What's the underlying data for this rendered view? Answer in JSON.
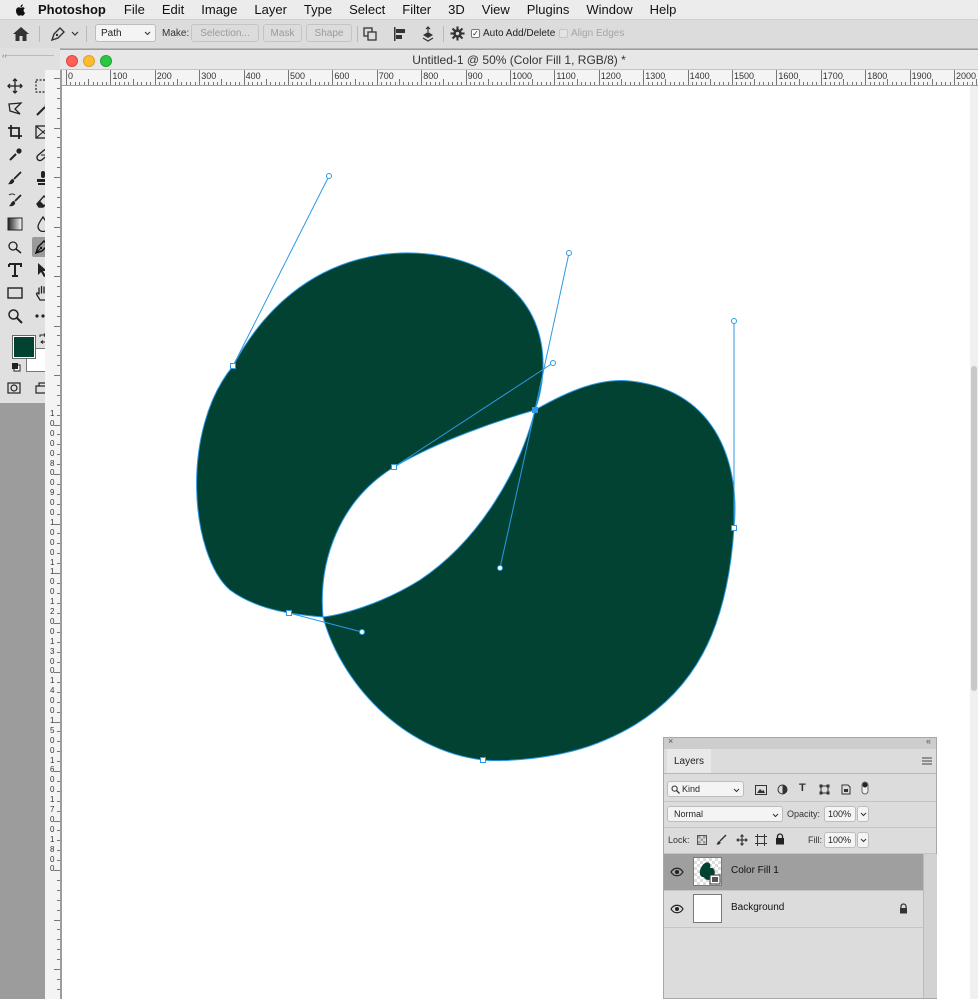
{
  "menubar": {
    "app": "Photoshop",
    "items": [
      "File",
      "Edit",
      "Image",
      "Layer",
      "Type",
      "Select",
      "Filter",
      "3D",
      "View",
      "Plugins",
      "Window",
      "Help"
    ]
  },
  "options": {
    "mode_value": "Path",
    "make_label": "Make:",
    "selection_button": "Selection...",
    "mask_button": "Mask",
    "shape_button": "Shape",
    "auto_add_delete": "Auto Add/Delete",
    "auto_add_delete_checked": true,
    "align_edges": "Align Edges",
    "align_edges_checked": false
  },
  "document": {
    "title": "Untitled-1 @ 50% (Color Fill 1, RGB/8) *",
    "shape_color": "#014232"
  },
  "rulers": {
    "h_labels": [
      "0",
      "100",
      "200",
      "300",
      "400",
      "500",
      "600",
      "700",
      "800",
      "900",
      "1000",
      "1100",
      "1200",
      "1300",
      "1400",
      "1500",
      "1600",
      "1700",
      "1800",
      "1900",
      "2000"
    ],
    "v_labels": [
      "1",
      "0",
      "0",
      "0",
      "0",
      "8",
      "0",
      "0",
      "9",
      "0",
      "0",
      "1",
      "0",
      "0",
      "0",
      "1",
      "1",
      "0",
      "0",
      "1",
      "2",
      "0",
      "0",
      "1",
      "3",
      "0",
      "0",
      "1",
      "4",
      "0",
      "0",
      "1",
      "5",
      "0",
      "0",
      "1",
      "6",
      "0",
      "0",
      "1",
      "7",
      "0",
      "0",
      "1",
      "8",
      "0",
      "0"
    ]
  },
  "tools": {
    "foreground_color": "#014232",
    "background_color": "#ffffff",
    "selected_tool": "pen-tool"
  },
  "layers_panel": {
    "tab": "Layers",
    "filter_kind": "Kind",
    "blend_mode": "Normal",
    "opacity_label": "Opacity:",
    "opacity_value": "100%",
    "lock_label": "Lock:",
    "fill_label": "Fill:",
    "fill_value": "100%",
    "layers": [
      {
        "name": "Color Fill 1",
        "selected": true,
        "locked": false
      },
      {
        "name": "Background",
        "selected": false,
        "locked": true
      }
    ]
  }
}
